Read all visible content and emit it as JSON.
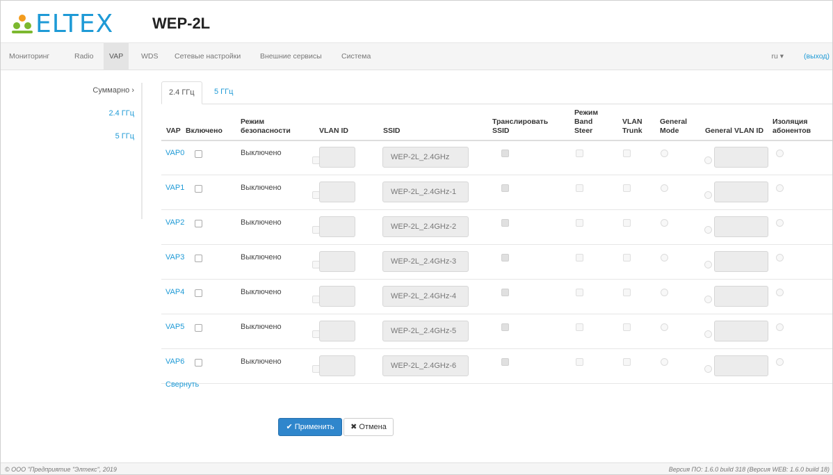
{
  "brand": {
    "name": "ELTEX",
    "logo_color": "#1e9ad6",
    "accent_orange": "#f39c1e"
  },
  "device": "WEP-2L",
  "nav": {
    "items": [
      "Мониторинг",
      "Radio",
      "VAP",
      "WDS",
      "Сетевые настройки",
      "Внешние сервисы",
      "Система"
    ],
    "active": "VAP",
    "lang": "ru ▾",
    "logout": "(выход)"
  },
  "sidebar": {
    "summary": "Суммарно ›",
    "items": [
      "2.4 ГГц",
      "5 ГГц"
    ]
  },
  "tabs": [
    "2.4 ГГц",
    "5 ГГц"
  ],
  "table": {
    "headers": {
      "vap": "VAP",
      "enabled": "Включено",
      "security": "Режим безопасности",
      "vlan": "VLAN ID",
      "ssid": "SSID",
      "broadcast": "Транслировать SSID",
      "band_steer": "Режим Band Steer",
      "vlan_trunk": "VLAN Trunk",
      "general_mode": "General Mode",
      "general_vlan": "General VLAN ID",
      "isolation": "Изоляция абонентов"
    },
    "rows": [
      {
        "vap": "VAP0",
        "mode": "Выключено",
        "ssid": "WEP-2L_2.4GHz"
      },
      {
        "vap": "VAP1",
        "mode": "Выключено",
        "ssid": "WEP-2L_2.4GHz-1"
      },
      {
        "vap": "VAP2",
        "mode": "Выключено",
        "ssid": "WEP-2L_2.4GHz-2"
      },
      {
        "vap": "VAP3",
        "mode": "Выключено",
        "ssid": "WEP-2L_2.4GHz-3"
      },
      {
        "vap": "VAP4",
        "mode": "Выключено",
        "ssid": "WEP-2L_2.4GHz-4"
      },
      {
        "vap": "VAP5",
        "mode": "Выключено",
        "ssid": "WEP-2L_2.4GHz-5"
      },
      {
        "vap": "VAP6",
        "mode": "Выключено",
        "ssid": "WEP-2L_2.4GHz-6"
      }
    ]
  },
  "collapse": "Свернуть",
  "buttons": {
    "apply": "✔ Применить",
    "cancel": "✖ Отмена"
  },
  "footer": {
    "left": "© ООО \"Предприятие \"Элтекс\", 2019",
    "right": "Версия ПО: 1.6.0 build 318 (Версия WEB: 1.6.0 build 18)"
  }
}
